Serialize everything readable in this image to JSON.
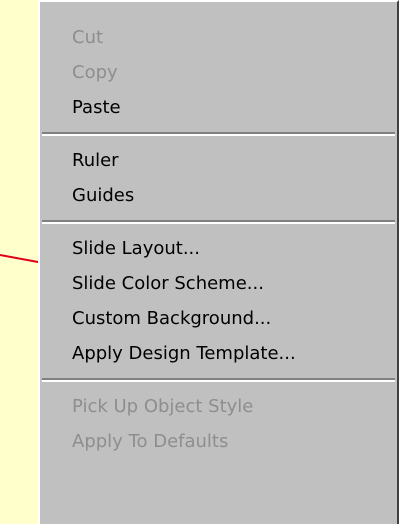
{
  "menu": {
    "groups": [
      {
        "items": [
          {
            "label": "Cut",
            "enabled": false
          },
          {
            "label": "Copy",
            "enabled": false
          },
          {
            "label": "Paste",
            "enabled": true
          }
        ]
      },
      {
        "items": [
          {
            "label": "Ruler",
            "enabled": true
          },
          {
            "label": "Guides",
            "enabled": true
          }
        ]
      },
      {
        "items": [
          {
            "label": "Slide Layout...",
            "enabled": true
          },
          {
            "label": "Slide Color Scheme...",
            "enabled": true
          },
          {
            "label": "Custom Background...",
            "enabled": true
          },
          {
            "label": "Apply Design Template...",
            "enabled": true
          }
        ]
      },
      {
        "items": [
          {
            "label": "Pick Up Object Style",
            "enabled": false
          },
          {
            "label": "Apply To Defaults",
            "enabled": false
          }
        ]
      }
    ]
  },
  "colors": {
    "background": "#ffffcc",
    "menu_face": "#c0c0c0",
    "disabled_text": "#8e8e8e",
    "pointer_line": "#e0001c"
  }
}
